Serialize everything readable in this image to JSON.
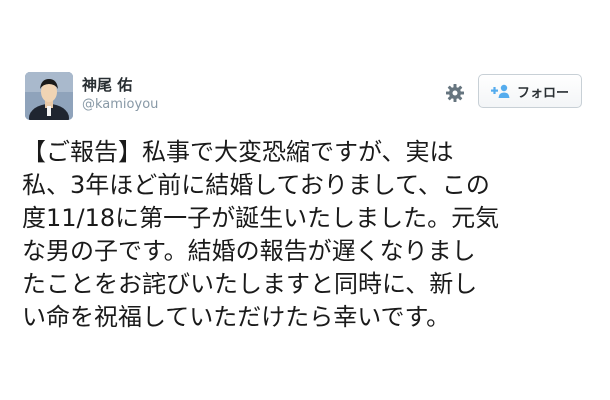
{
  "user": {
    "display_name": "神尾 佑",
    "handle": "@kamioyou"
  },
  "actions": {
    "settings_icon": "gear-icon",
    "follow_icon": "add-user-icon",
    "follow_label": "フォロー"
  },
  "tweet": {
    "lines": [
      "【ご報告】私事で大変恐縮ですが、実は",
      "私、3年ほど前に結婚しておりまして、この",
      "度11/18に第一子が誕生いたしました。元気",
      "な男の子です。結婚の報告が遅くなりまし",
      "たことをお詫びいたしますと同時に、新し",
      "い命を祝福していただけたら幸いです。"
    ]
  },
  "colors": {
    "handle": "#8899a6",
    "text": "#1a1a1a",
    "follow_accent": "#55acee",
    "gear": "#66757f"
  }
}
